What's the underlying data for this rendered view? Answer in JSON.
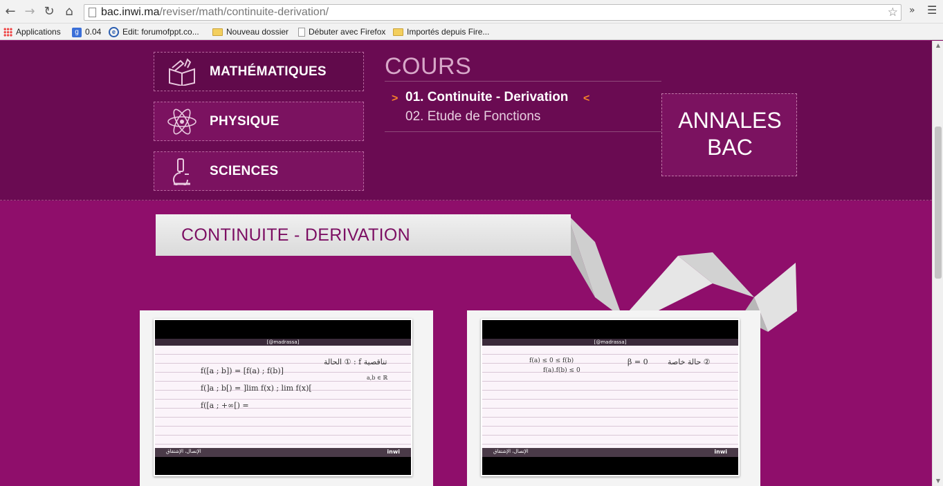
{
  "browser": {
    "url_host": "bac.inwi.ma",
    "url_path": "/reviser/math/continuite-derivation/",
    "extensions_label": "»",
    "bookmarks": [
      {
        "label": "Applications",
        "icon": "apps-grid-icon"
      },
      {
        "label": "0.04",
        "icon": "google-icon"
      },
      {
        "label": "Edit: forumofppt.co...",
        "icon": "edit-icon"
      },
      {
        "label": "Nouveau dossier",
        "icon": "folder-icon"
      },
      {
        "label": "Débuter avec Firefox",
        "icon": "page-icon"
      },
      {
        "label": "Importés depuis Fire...",
        "icon": "folder-icon"
      }
    ]
  },
  "subjects": [
    {
      "label": "MATHÉMATIQUES",
      "icon": "book-pencil-icon",
      "active": true
    },
    {
      "label": "PHYSIQUE",
      "icon": "atom-icon",
      "active": false
    },
    {
      "label": "SCIENCES",
      "icon": "microscope-icon",
      "active": false
    }
  ],
  "cours": {
    "title": "COURS",
    "items": [
      {
        "label": "01. Continuite - Derivation",
        "active": true
      },
      {
        "label": "02. Etude de Fonctions",
        "active": false
      }
    ],
    "left_marker": ">",
    "right_marker": "<"
  },
  "annales": {
    "line1": "ANNALES",
    "line2": "BAC"
  },
  "section": {
    "title": "CONTINUITE - DERIVATION"
  },
  "videos": [
    {
      "header": "[@madrassa]",
      "footer_text": "الإتصال، الإشتقاق",
      "footer_logo": "inwi",
      "lines": [
        "f([a ; b]) = [f(a) ; f(b)]",
        "f(]a ; b[) = ]lim f(x) ; lim f(x)[",
        "f([a ; +∞[) =",
        "الحالة ① : f تناقصية",
        "a,b ∈ ℝ"
      ]
    },
    {
      "header": "[@madrassa]",
      "footer_text": "الإتصال، الإشتقاق",
      "footer_logo": "inwi",
      "lines": [
        "f(a) ≤ 0 ≤ f(b)",
        "f(a).f(b) ≤ 0",
        "β = 0",
        "حالة خاصة ②"
      ]
    }
  ],
  "colors": {
    "header_band": "#6a0b52",
    "content_band": "#8f0e6b",
    "accent_orange": "#f7822a",
    "title_purple": "#7c0f63"
  }
}
